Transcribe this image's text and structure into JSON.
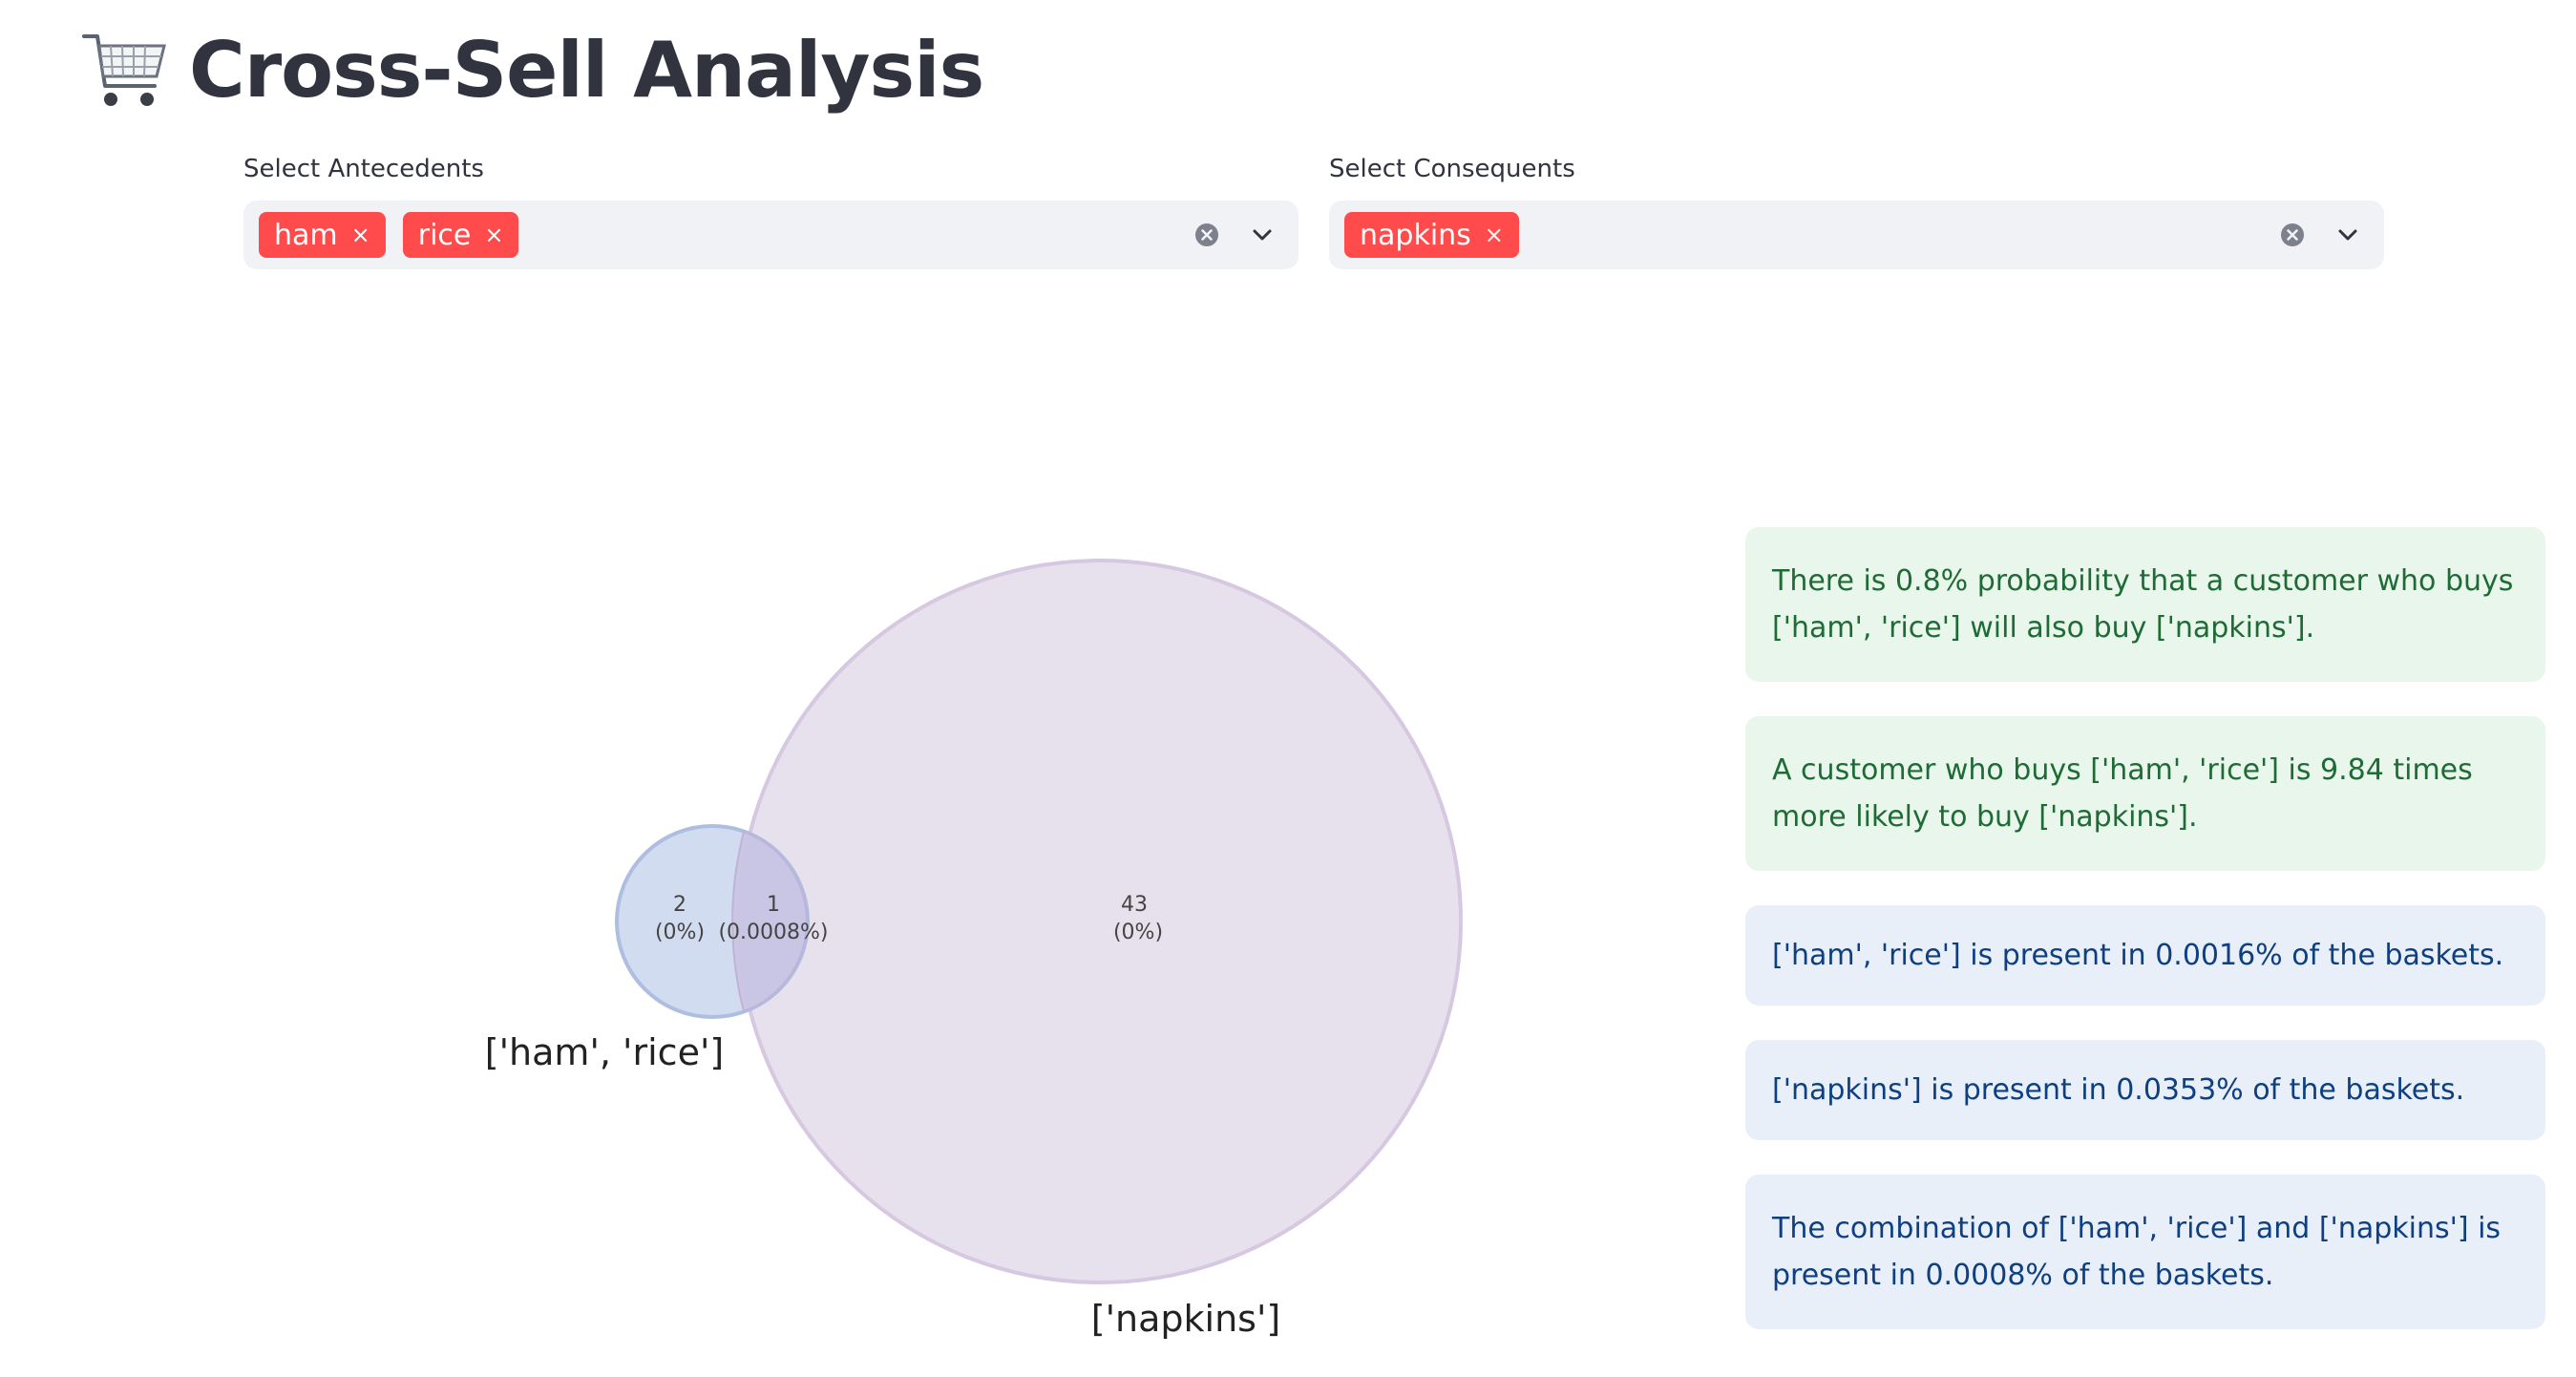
{
  "page": {
    "title": "Cross-Sell Analysis",
    "title_icon": "shopping-cart-icon"
  },
  "antecedents": {
    "label": "Select Antecedents",
    "selected": [
      "ham",
      "rice"
    ]
  },
  "consequents": {
    "label": "Select Consequents",
    "selected": [
      "napkins"
    ]
  },
  "tag_remove_glyph": "×",
  "venn": {
    "set_a_label": "['ham', 'rice']",
    "set_b_label": "['napkins']",
    "a_only": {
      "count": "2",
      "pct": "(0%)"
    },
    "intersection": {
      "count": "1",
      "pct": "(0.0008%)"
    },
    "b_only": {
      "count": "43",
      "pct": "(0%)"
    },
    "colors": {
      "a": "#c7d3ec",
      "b": "#e3dbea"
    }
  },
  "alerts": [
    {
      "type": "success",
      "text": "There is 0.8% probability that a customer who buys ['ham', 'rice'] will also buy ['napkins']."
    },
    {
      "type": "success",
      "text": "A customer who buys ['ham', 'rice'] is 9.84 times more likely to buy ['napkins']."
    },
    {
      "type": "info",
      "text": "['ham', 'rice'] is present in 0.0016% of the baskets."
    },
    {
      "type": "info",
      "text": "['napkins'] is present in 0.0353% of the baskets."
    },
    {
      "type": "info",
      "text": "The combination of ['ham', 'rice'] and ['napkins'] is present in 0.0008% of the baskets."
    }
  ],
  "colors": {
    "tag": "#ff4b4b",
    "select_bg": "#f0f2f6",
    "success_bg": "#e9f6ec",
    "success_text": "#1f6b36",
    "info_bg": "#e8eff9",
    "info_text": "#0e3f80"
  }
}
